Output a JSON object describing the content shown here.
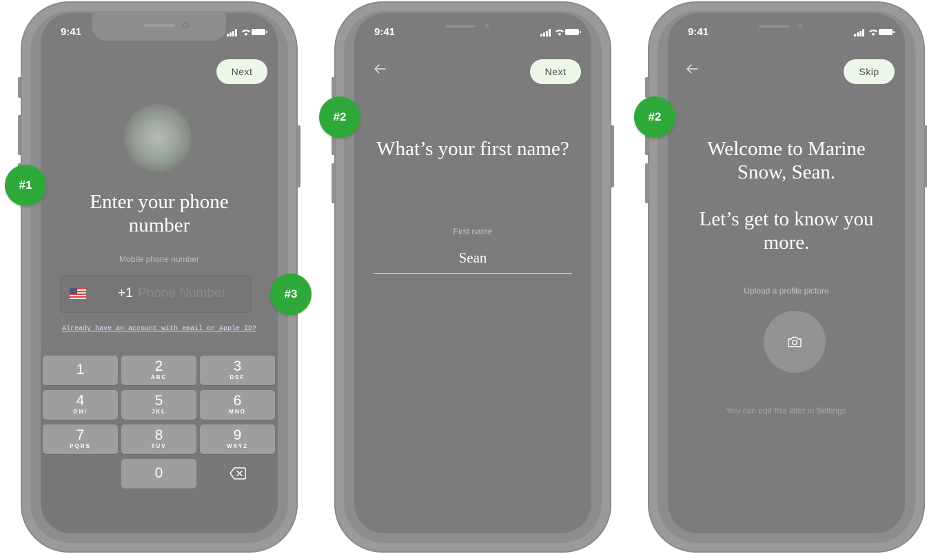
{
  "screens": [
    {
      "status_time": "9:41",
      "action_label": "Next",
      "title": "Enter your phone number",
      "field_label": "Mobile phone number",
      "country_code": "+1",
      "phone_placeholder": "Phone Number",
      "account_link": "Already have an account with email or Apple ID?",
      "keypad": [
        {
          "digit": "1",
          "letters": ""
        },
        {
          "digit": "2",
          "letters": "ABC"
        },
        {
          "digit": "3",
          "letters": "DEF"
        },
        {
          "digit": "4",
          "letters": "GHI"
        },
        {
          "digit": "5",
          "letters": "JKL"
        },
        {
          "digit": "6",
          "letters": "MNO"
        },
        {
          "digit": "7",
          "letters": "PQRS"
        },
        {
          "digit": "8",
          "letters": "TUV"
        },
        {
          "digit": "9",
          "letters": "WXYZ"
        },
        {
          "digit": "0",
          "letters": ""
        }
      ]
    },
    {
      "status_time": "9:41",
      "action_label": "Next",
      "title": "What’s your first name?",
      "field_label": "First name",
      "field_value": "Sean"
    },
    {
      "status_time": "9:41",
      "action_label": "Skip",
      "title_line1": "Welcome to Marine",
      "title_line2": "Snow, Sean.",
      "title_line3": "Let’s get to know you",
      "title_line4": "more.",
      "upload_label": "Upload a profile picture",
      "edit_note": "You can edit this later in Settings"
    }
  ],
  "badges": [
    "#1",
    "#2",
    "#2",
    "#3"
  ],
  "colors": {
    "badge": "#2fa83a",
    "pill_bg": "#ecf7ea",
    "screen_bg": "#7c7c7c",
    "link": "#e8d8f8"
  },
  "icons": [
    "us-flag-icon",
    "back-arrow-icon",
    "camera-icon",
    "backspace-icon",
    "signal-icon",
    "wifi-icon",
    "battery-icon"
  ]
}
